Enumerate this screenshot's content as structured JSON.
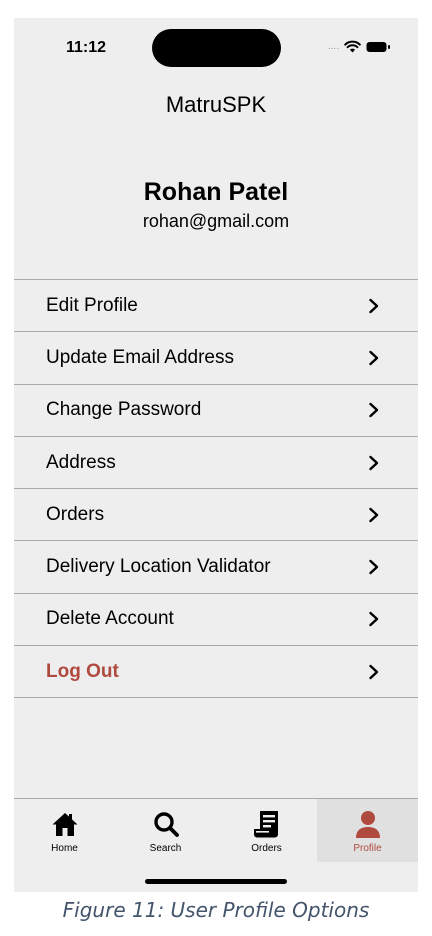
{
  "status_bar": {
    "time": "11:12",
    "signal": "....",
    "icons": [
      "wifi-icon",
      "battery-icon"
    ]
  },
  "app": {
    "title": "MatruSPK"
  },
  "user": {
    "name": "Rohan Patel",
    "email": "rohan@gmail.com"
  },
  "menu": {
    "items": [
      {
        "label": "Edit Profile"
      },
      {
        "label": "Update Email Address"
      },
      {
        "label": "Change Password"
      },
      {
        "label": "Address"
      },
      {
        "label": "Orders"
      },
      {
        "label": "Delivery Location Validator"
      },
      {
        "label": "Delete Account"
      },
      {
        "label": "Log Out"
      }
    ],
    "logout_color": "#b04a3e",
    "chevron_icon": "chevron-right-icon"
  },
  "tabbar": {
    "tabs": [
      {
        "label": "Home",
        "icon": "home-icon"
      },
      {
        "label": "Search",
        "icon": "search-icon"
      },
      {
        "label": "Orders",
        "icon": "receipt-icon"
      },
      {
        "label": "Profile",
        "icon": "person-icon"
      }
    ],
    "active": "Profile",
    "active_color": "#b04a3e"
  },
  "caption": "Figure 11: User Profile Options"
}
